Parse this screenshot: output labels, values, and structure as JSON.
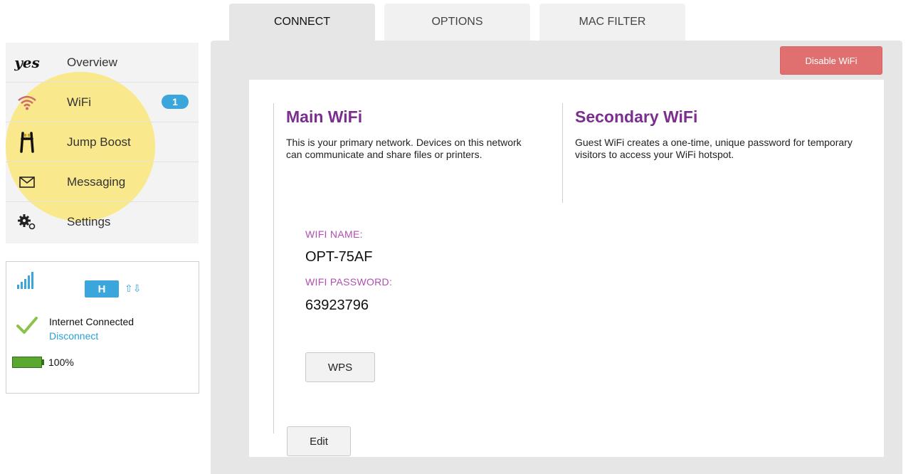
{
  "tabs": [
    {
      "label": "CONNECT"
    },
    {
      "label": "OPTIONS"
    },
    {
      "label": "MAC FILTER"
    }
  ],
  "sidebar": {
    "items": [
      {
        "label": "Overview",
        "icon": "yes-logo-icon"
      },
      {
        "label": "WiFi",
        "icon": "wifi-icon",
        "badge": "1"
      },
      {
        "label": "Jump Boost",
        "icon": "jump-boost-icon"
      },
      {
        "label": "Messaging",
        "icon": "envelope-icon"
      },
      {
        "label": "Settings",
        "icon": "gears-icon"
      }
    ],
    "logo_text": "yes"
  },
  "status": {
    "network_type": "H",
    "connection_text": "Internet Connected",
    "disconnect_label": "Disconnect",
    "battery": "100%",
    "battery_level": 1.0
  },
  "toolbar": {
    "disable_wifi_label": "Disable WiFi"
  },
  "main_wifi": {
    "title": "Main WiFi",
    "description": "This is your primary network. Devices on this network can communicate and share files or printers.",
    "name_label": "WIFI NAME:",
    "name_value": "OPT-75AF",
    "password_label": "WIFI PASSWORD:",
    "password_value": "63923796",
    "wps_label": "WPS",
    "edit_label": "Edit"
  },
  "secondary_wifi": {
    "title": "Secondary WiFi",
    "description": "Guest WiFi creates a one-time, unique password for temporary visitors to access your WiFi hotspot."
  },
  "colors": {
    "accent_purple": "#7a2f8e",
    "label_pink": "#b04fb0",
    "badge_blue": "#3aa6dc",
    "disable_red": "#e07070",
    "highlight_yellow": "#fbe56e"
  }
}
